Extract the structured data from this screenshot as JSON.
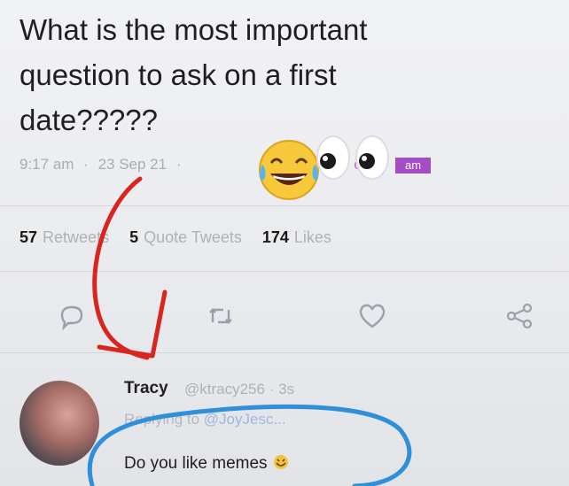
{
  "tweet": {
    "text": "What is the most important\nquestion to ask on a first\ndate?????",
    "time": "9:17 am",
    "sep": "·",
    "date": "23 Sep 21",
    "sep2": "·",
    "via_fragment": "oid",
    "tag_text": "am"
  },
  "stats": {
    "retweets_count": "57",
    "retweets_label": "Retweets",
    "quotes_count": "5",
    "quotes_label": "Quote Tweets",
    "likes_count": "174",
    "likes_label": "Likes"
  },
  "reply": {
    "name": "Tracy",
    "handle": "@ktracy256",
    "sep": "·",
    "age": "3s",
    "replying_prefix": "Replying to",
    "replying_handle": "@JoyJesc...",
    "text": "Do you like memes"
  },
  "colors": {
    "annotation_red": "#d8261f",
    "annotation_blue": "#2f8fd8",
    "tag_purple": "#a34cc6"
  },
  "icons": [
    "reply-icon",
    "retweet-icon",
    "like-icon",
    "share-icon",
    "laughing-emoji-icon",
    "eyes-emoji-icon",
    "smile-emoji-icon"
  ]
}
